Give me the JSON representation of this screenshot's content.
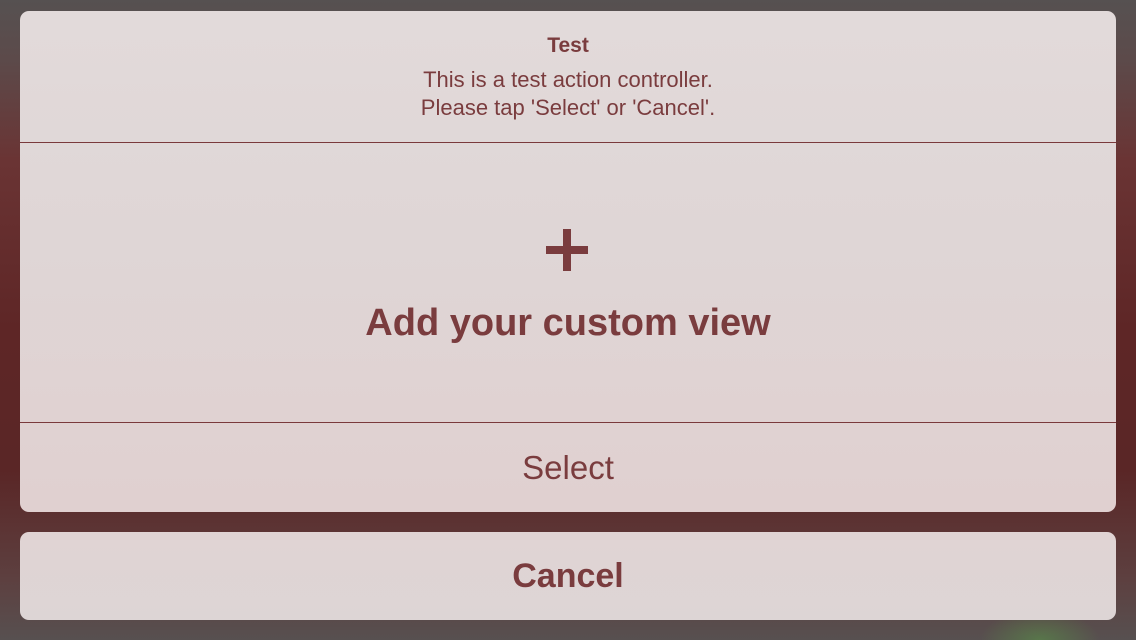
{
  "alert": {
    "title": "Test",
    "message_lines": [
      "This is a test action controller.",
      "Please tap 'Select' or 'Cancel'."
    ]
  },
  "custom_view": {
    "icon": "plus-icon",
    "label": "Add your custom view"
  },
  "actions": {
    "select_label": "Select",
    "cancel_label": "Cancel"
  },
  "colors": {
    "accent": "#7a3c3e",
    "sheet_background": "#e0d6d6",
    "backdrop": "#5e2626"
  }
}
